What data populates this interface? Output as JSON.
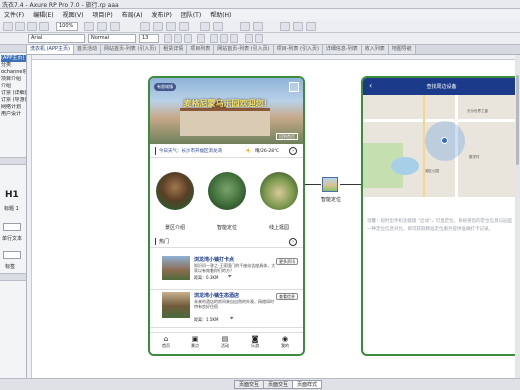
{
  "app": {
    "title": "洗衣7.4 - Axure RP Pro 7.0 - 旅行.rp aaa",
    "menu": [
      "文件(F)",
      "编辑(E)",
      "视图(V)",
      "项目(P)",
      "布局(A)",
      "发布(P)",
      "团队(T)",
      "帮助(H)"
    ],
    "zoom": "100%",
    "font_family": "Arial",
    "font_style": "Normal",
    "font_size": "13"
  },
  "left_panel": {
    "items": [
      "(APP主页)",
      "分类",
      "ochannel接入页",
      "项目介绍",
      "介绍",
      "订票 (详细)",
      "订票 (导游)",
      "网络计划",
      "用户设计"
    ],
    "heading_label": "H1",
    "heading_caption": "标题 1",
    "text_label": "单行文本",
    "widget_caption": "标签"
  },
  "tabs": {
    "items": [
      "洗衣机 (APP主页)",
      "首页活动",
      "网站首页-列表 (引入页)",
      "租赁详情",
      "项目列表",
      "网站首页-列表 (引入页)",
      "项目-列表 (引入页)",
      "详细信息-列表",
      "收入列表",
      "地图导航"
    ]
  },
  "phone1": {
    "header_tag": "有限城镇",
    "banner_title": "麦格尼蒙乌乐园欢迎您！",
    "banner_button": "回到首页",
    "weather_text": "今日天气：长沙市开福区浏龙湾",
    "weather_value": "晴/26-28℃",
    "icon_labels": [
      "景区介绍",
      "智能定位",
      "线上逛园"
    ],
    "section_title": "热门",
    "news": [
      {
        "title": "浏龙湾小镇打卡点",
        "desc": "知识问一答之·王家国门的千座站告座具体，大家以有效着你们的方？",
        "distance": "距离：0.3KM",
        "button": "更多资讯"
      },
      {
        "title": "浏龙湾小镇生态酒店",
        "desc": "未来的酒店的房间来自自然的外观，网络如时特有良好住宿",
        "distance": "距离：1.5KM",
        "button": "查看信息"
      }
    ],
    "nav": [
      "首页",
      "景点",
      "活动",
      "乐游",
      "我的"
    ]
  },
  "connector_label": "智能定位",
  "phone2": {
    "title": "查找周边设备",
    "map_labels": [
      "长沙世界之窗",
      "湖区公园",
      "数学村"
    ],
    "note": "温馨：短时出手机功能版 \"启动\"，可直定位，系统将您的定位信息与园里一种定位信息对比，即可获取精准定位服务提供准确打卡记录。"
  },
  "status_tabs": [
    "页面交互",
    "页面交互",
    "页面样式"
  ],
  "colors": {
    "phone_border": "#3d8b3d",
    "header_blue": "#1b3b8a",
    "accent_blue": "#2d4fa0"
  }
}
